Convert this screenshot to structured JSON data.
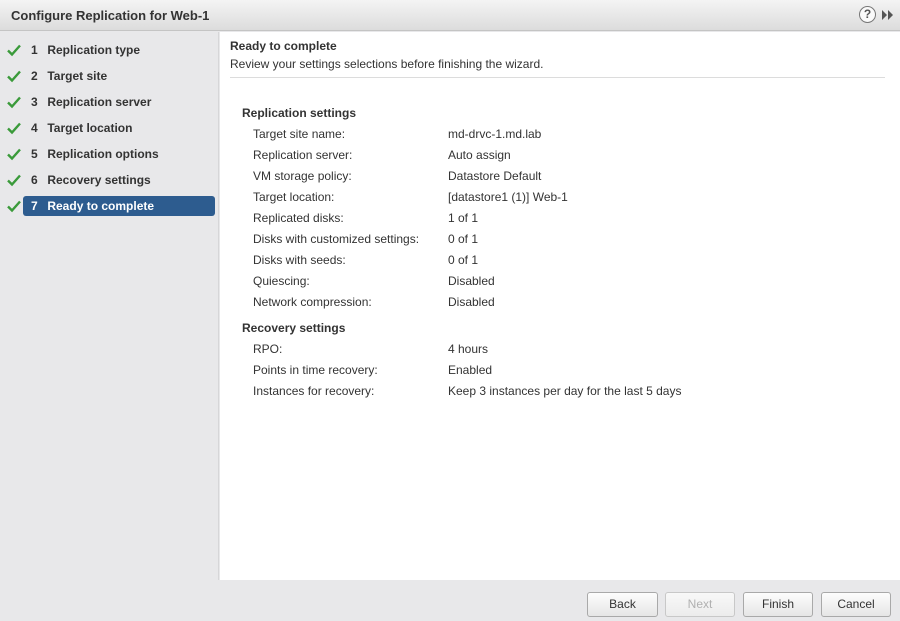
{
  "window": {
    "title": "Configure Replication for Web-1",
    "help_icon_glyph": "?"
  },
  "steps": [
    {
      "num": "1",
      "label": "Replication type",
      "completed": true
    },
    {
      "num": "2",
      "label": "Target site",
      "completed": true
    },
    {
      "num": "3",
      "label": "Replication server",
      "completed": true
    },
    {
      "num": "4",
      "label": "Target location",
      "completed": true
    },
    {
      "num": "5",
      "label": "Replication options",
      "completed": true
    },
    {
      "num": "6",
      "label": "Recovery settings",
      "completed": true
    },
    {
      "num": "7",
      "label": "Ready to complete",
      "completed": true,
      "active": true
    }
  ],
  "main": {
    "heading": "Ready to complete",
    "subtitle": "Review your settings selections before finishing the wizard."
  },
  "replication_settings": {
    "title": "Replication settings",
    "rows": [
      {
        "label": "Target site name:",
        "value": "md-drvc-1.md.lab"
      },
      {
        "label": "Replication server:",
        "value": "Auto assign"
      },
      {
        "label": "VM storage policy:",
        "value": "Datastore Default"
      },
      {
        "label": "Target location:",
        "value": "[datastore1 (1)] Web-1"
      },
      {
        "label": "Replicated disks:",
        "value": "1 of 1"
      },
      {
        "label": "Disks with customized settings:",
        "value": "0 of 1"
      },
      {
        "label": "Disks with seeds:",
        "value": "0 of 1"
      },
      {
        "label": "Quiescing:",
        "value": "Disabled"
      },
      {
        "label": "Network compression:",
        "value": "Disabled"
      }
    ]
  },
  "recovery_settings": {
    "title": "Recovery settings",
    "rows": [
      {
        "label": "RPO:",
        "value": "4 hours"
      },
      {
        "label": "Points in time recovery:",
        "value": "Enabled"
      },
      {
        "label": "Instances for recovery:",
        "value": "Keep 3 instances per day for the last 5 days"
      }
    ]
  },
  "footer": {
    "back_label": "Back",
    "next_label": "Next",
    "finish_label": "Finish",
    "cancel_label": "Cancel"
  },
  "colors": {
    "active_step": "#2d5c8f",
    "check": "#3a9a3a"
  }
}
